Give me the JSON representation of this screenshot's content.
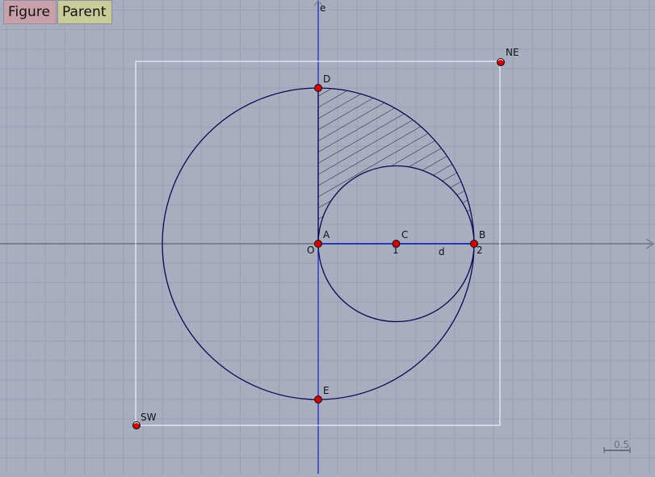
{
  "toolbar": {
    "figure_label": "Figure",
    "parent_label": "Parent"
  },
  "axes": {
    "vertical_axis_label": "e",
    "origin_label": "O",
    "tick_1": "1",
    "tick_2": "2"
  },
  "points": {
    "A": "A",
    "B": "B",
    "C": "C",
    "D": "D",
    "E": "E",
    "NE": "NE",
    "SW": "SW"
  },
  "segment_label": "d",
  "scale": {
    "label": "0.5"
  },
  "colors": {
    "background": "#a8aec0",
    "grid": "#98a0b4",
    "axis": "#7a7f8c",
    "vertical_axis": "#1020c0",
    "curve": "#0a0a50",
    "point_fill": "#cc0000",
    "frame": "#ffffff"
  }
}
